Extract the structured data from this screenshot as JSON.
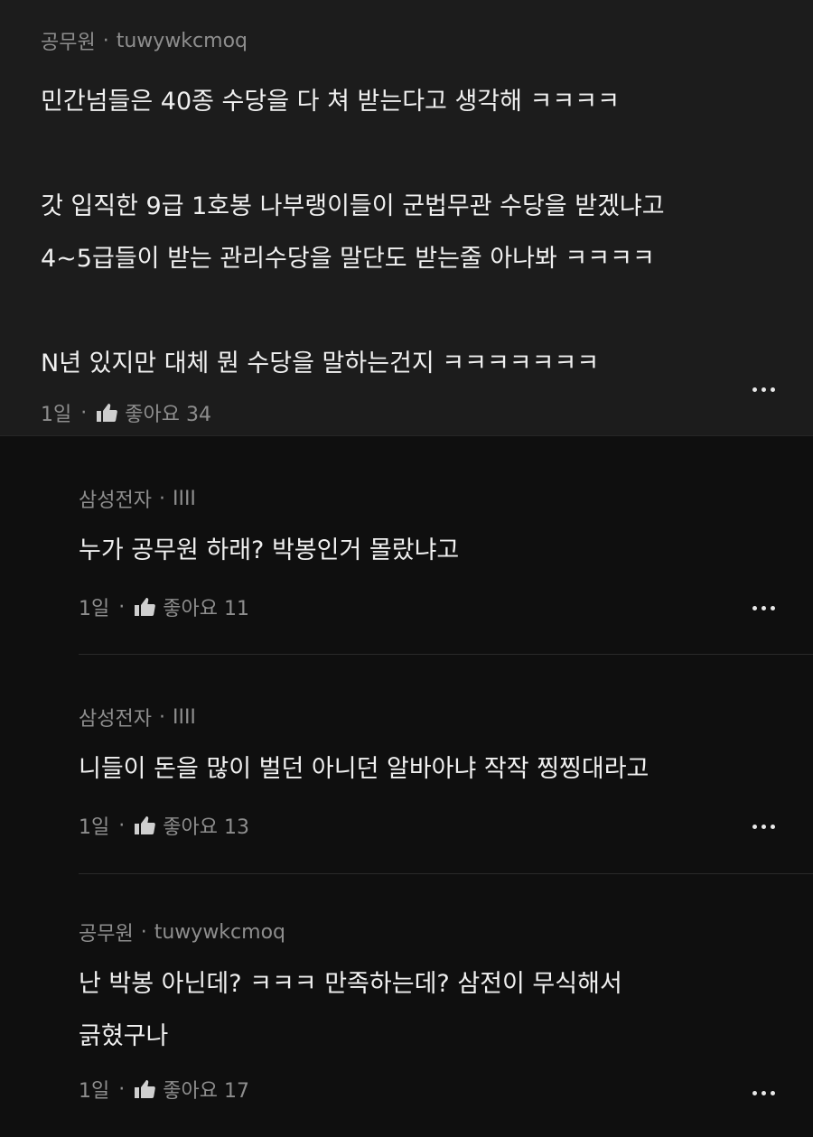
{
  "comments": [
    {
      "author": "공무원",
      "handle": "tuwywkcmoq",
      "lines": [
        "민간넘들은 40종 수당을 다 쳐 받는다고 생각해 ㅋㅋㅋㅋ",
        "",
        "갓 입직한 9급 1호봉 나부랭이들이 군법무관 수당을 받겠냐고",
        "4~5급들이 받는 관리수당을 말단도 받는줄 아나봐 ㅋㅋㅋㅋ",
        "",
        "N년 있지만 대체 뭔 수당을 말하는건지 ㅋㅋㅋㅋㅋㅋㅋ"
      ],
      "time": "1일",
      "likes_label": "좋아요 34"
    },
    {
      "author": "삼성전자",
      "handle": "IIII",
      "lines": [
        "누가 공무원 하래? 박봉인거 몰랐냐고"
      ],
      "time": "1일",
      "likes_label": "좋아요 11"
    },
    {
      "author": "삼성전자",
      "handle": "IIII",
      "lines": [
        "니들이 돈을 많이 벌던 아니던 알바아냐 작작 찡찡대라고"
      ],
      "time": "1일",
      "likes_label": "좋아요 13"
    },
    {
      "author": "공무원",
      "handle": "tuwywkcmoq",
      "lines": [
        "난 박봉 아닌데? ㅋㅋㅋ 만족하는데? 삼전이 무식해서",
        "긁혔구나"
      ],
      "time": "1일",
      "likes_label": "좋아요 17"
    }
  ],
  "separator": "·",
  "icons": {
    "like": "thumbs-up-icon",
    "more": "more-options-icon"
  }
}
